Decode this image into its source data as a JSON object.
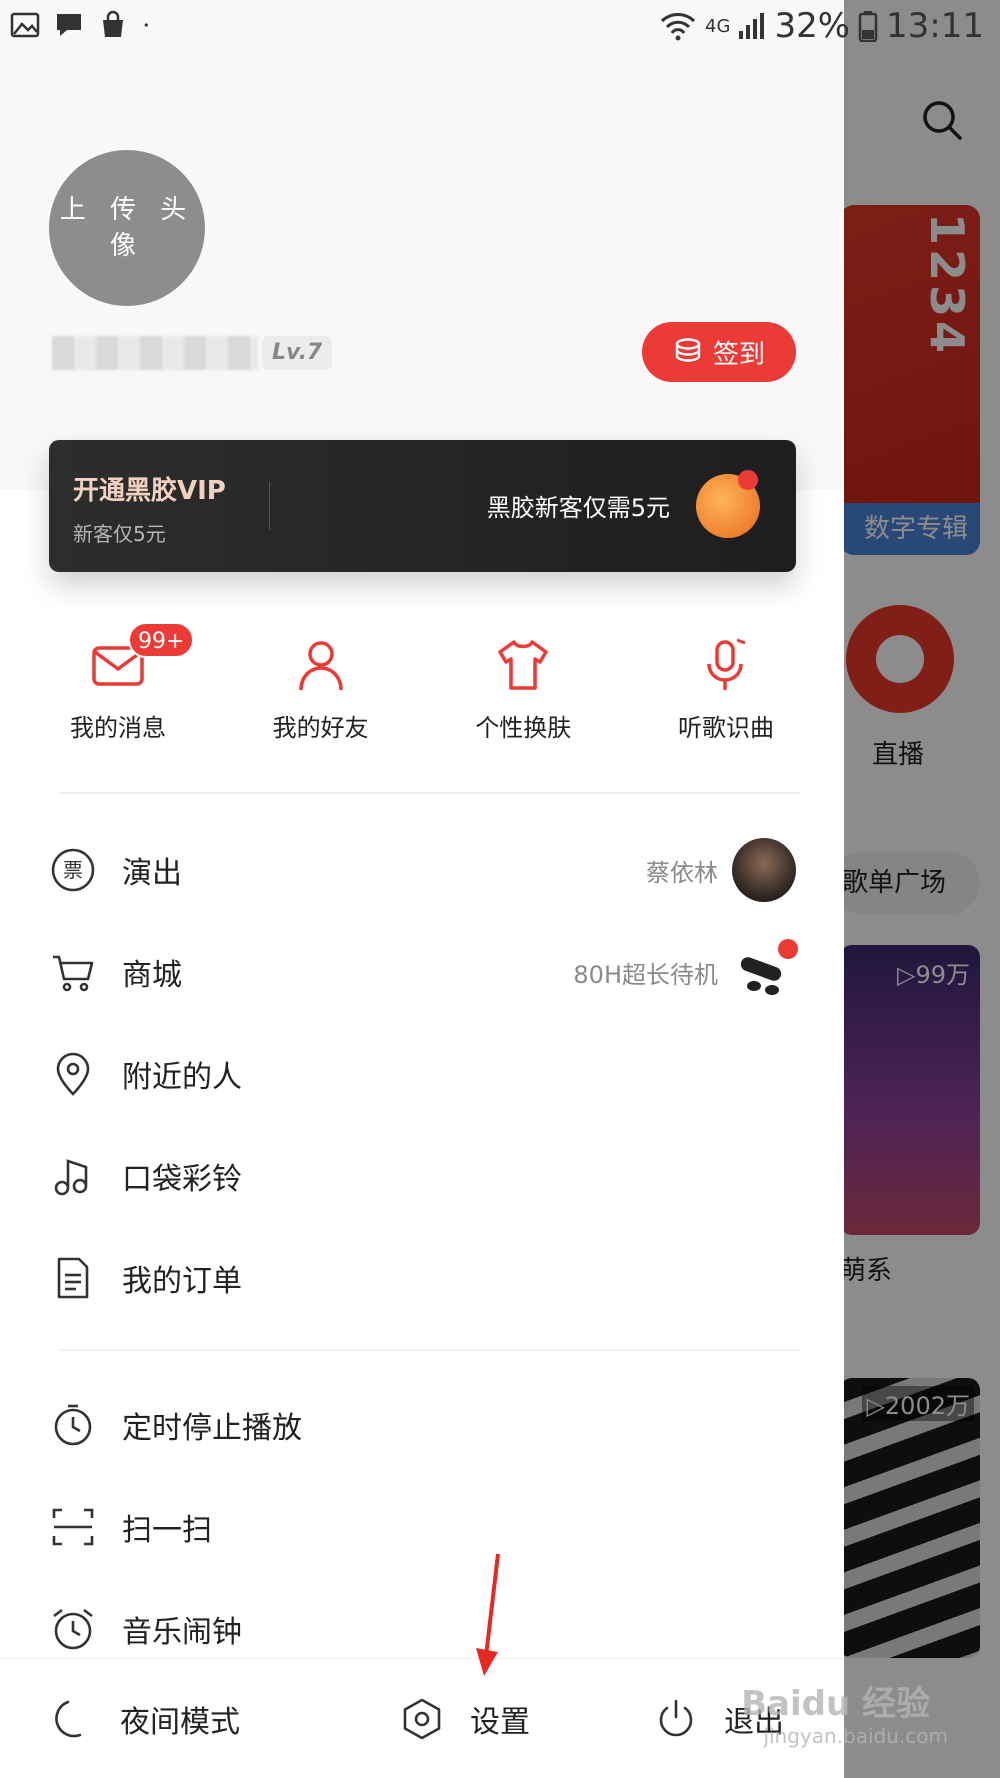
{
  "status_bar": {
    "battery": "32%",
    "time": "13:11",
    "network": "4G"
  },
  "profile": {
    "avatar_text": "上 传 头 像",
    "level": "Lv.7",
    "checkin_label": "签到"
  },
  "vip": {
    "title": "开通黑胶VIP",
    "subtitle": "新客仅5元",
    "promo": "黑胶新客仅需5元"
  },
  "quick_actions": [
    {
      "label": "我的消息",
      "badge": "99+"
    },
    {
      "label": "我的好友"
    },
    {
      "label": "个性换肤"
    },
    {
      "label": "听歌识曲"
    }
  ],
  "menu_group1": [
    {
      "label": "演出",
      "extra": "蔡依林"
    },
    {
      "label": "商城",
      "extra": "80H超长待机"
    },
    {
      "label": "附近的人"
    },
    {
      "label": "口袋彩铃"
    },
    {
      "label": "我的订单"
    }
  ],
  "menu_group2": [
    {
      "label": "定时停止播放"
    },
    {
      "label": "扫一扫"
    },
    {
      "label": "音乐闹钟"
    }
  ],
  "bottom_bar": {
    "night_mode": "夜间模式",
    "settings": "设置",
    "logout": "退出"
  },
  "background": {
    "banner_digits": "1234",
    "banner_tag": "数字专辑",
    "live_label": "直播",
    "playlist_square": "歌单广场",
    "card1_plays": "▷99万",
    "tag2": "萌系",
    "card2_plays": "▷2002万"
  },
  "watermark": {
    "main": "Baidu 经验",
    "sub": "jingyan.baidu.com"
  },
  "colors": {
    "accent": "#ec3a36",
    "vip_bg": "#222222",
    "text": "#222222",
    "muted": "#8a8a8a"
  }
}
